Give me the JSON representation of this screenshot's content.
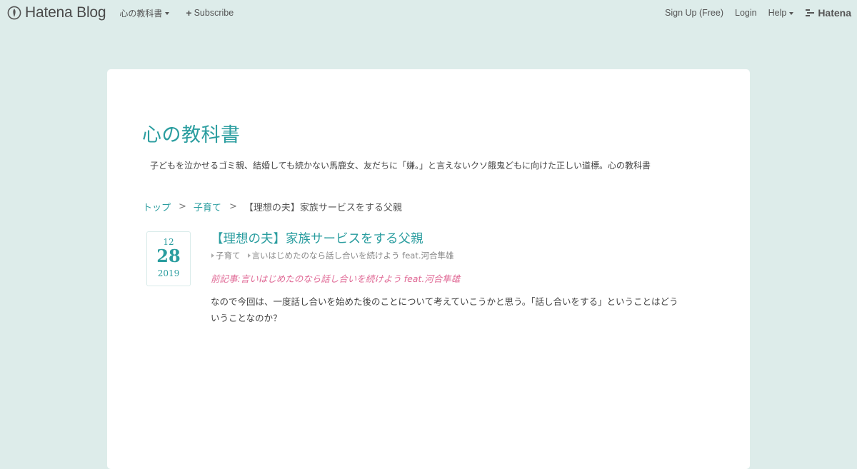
{
  "globalbar": {
    "logo_text": "Hatena Blog",
    "blog_menu_label": "心の教科書",
    "subscribe_label": "Subscribe",
    "signup_label": "Sign Up (Free)",
    "login_label": "Login",
    "help_label": "Help",
    "hatena_label": "Hatena"
  },
  "blog": {
    "title": "心の教科書",
    "description": "子どもを泣かせるゴミ親、結婚しても続かない馬鹿女、友だちに「嫌。」と言えないクソ餓鬼どもに向けた正しい道標。心の教科書"
  },
  "breadcrumb": {
    "top": "トップ",
    "sep1": ">",
    "category": "子育て",
    "sep2": ">",
    "current": "【理想の夫】家族サービスをする父親"
  },
  "entry": {
    "date": {
      "month": "12",
      "day": "28",
      "year": "2019"
    },
    "title": "【理想の夫】家族サービスをする父親",
    "categories": [
      "子育て",
      "言いはじめたのなら話し合いを続けよう feat.河合隼雄"
    ],
    "prev_link": "前記事:言いはじめたのなら話し合いを続けよう feat.河合隼雄",
    "body": "なので今回は、一度話し合いを始めた後のことについて考えていこうかと思う。「話し合いをする」ということはどういうことなのか？"
  },
  "colors": {
    "background": "#ddecea",
    "accent": "#2a9d9f",
    "prev_link": "#e06a96"
  }
}
